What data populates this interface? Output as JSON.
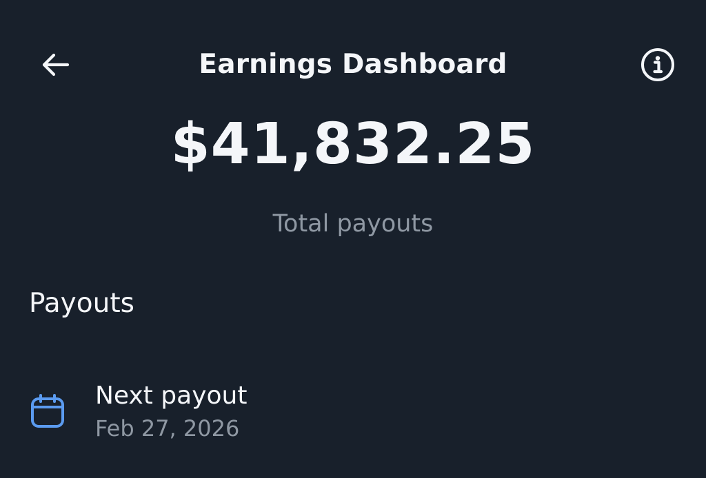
{
  "header": {
    "title": "Earnings Dashboard",
    "back_icon": "arrow-left-icon",
    "info_icon": "info-circle-icon"
  },
  "summary": {
    "total_amount": "$41,832.25",
    "total_label": "Total payouts"
  },
  "payouts_section": {
    "heading": "Payouts",
    "items": [
      {
        "icon": "calendar-icon",
        "title": "Next payout",
        "date": "Feb 27, 2026"
      }
    ]
  },
  "colors": {
    "background": "#18202b",
    "primary_text": "#f4f6f9",
    "secondary_text": "#8f98a3",
    "accent": "#5b9bf0"
  }
}
